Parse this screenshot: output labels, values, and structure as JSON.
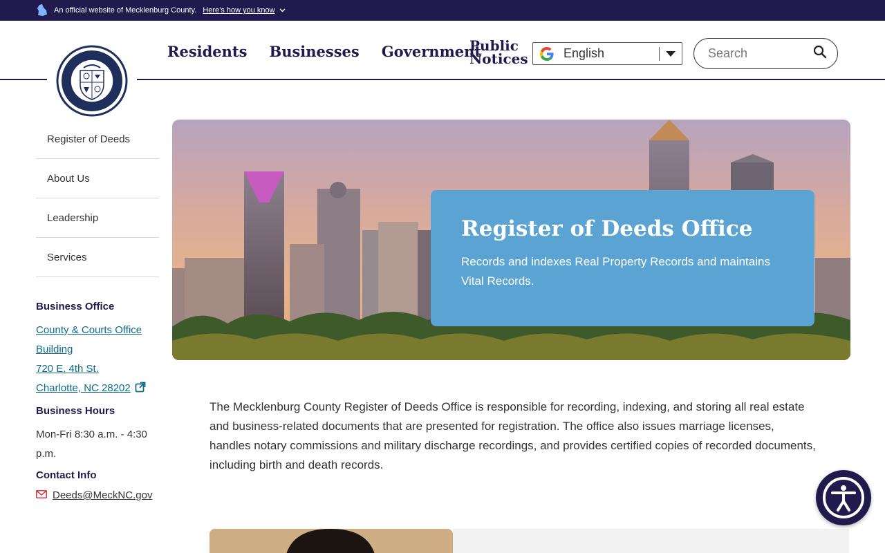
{
  "official_bar": {
    "text": "An official website of Mecklenburg County.",
    "link": "Here’s how you know"
  },
  "nav": {
    "items": [
      "Residents",
      "Businesses",
      "Government"
    ],
    "public_notices_line1": "Public",
    "public_notices_line2": "Notices"
  },
  "language": {
    "selected": "English"
  },
  "search": {
    "placeholder": "Search"
  },
  "sidebar": {
    "items": [
      "Register of Deeds",
      "About Us",
      "Leadership",
      "Services"
    ]
  },
  "business_office": {
    "heading": "Business Office",
    "address_line1": "County & Courts Office",
    "address_line2": "Building",
    "address_line3": "720 E. 4th St.",
    "address_line4": "Charlotte, NC 28202"
  },
  "business_hours": {
    "heading": "Business Hours",
    "line1": "Mon-Fri 8:30 a.m. - 4:30",
    "line2": "p.m."
  },
  "contact": {
    "heading": "Contact Info",
    "email": "Deeds@MeckNC.gov"
  },
  "hero": {
    "title": "Register of Deeds Office",
    "subtitle_line1": "Records and indexes Real Property Records and maintains",
    "subtitle_line2": "Vital Records."
  },
  "intro": {
    "text": "The Mecklenburg County Register of Deeds Office is responsible for recording, indexing, and storing all real estate and business-related documents that are presented for registration. The office also issues marriage licenses, handles notary commissions and military discharge recordings, and provides certified copies of recorded documents, including birth and death records."
  },
  "colors": {
    "brand_navy": "#211a4c",
    "hero_card": "#5aa3d2",
    "link_teal": "#0f6a88"
  }
}
